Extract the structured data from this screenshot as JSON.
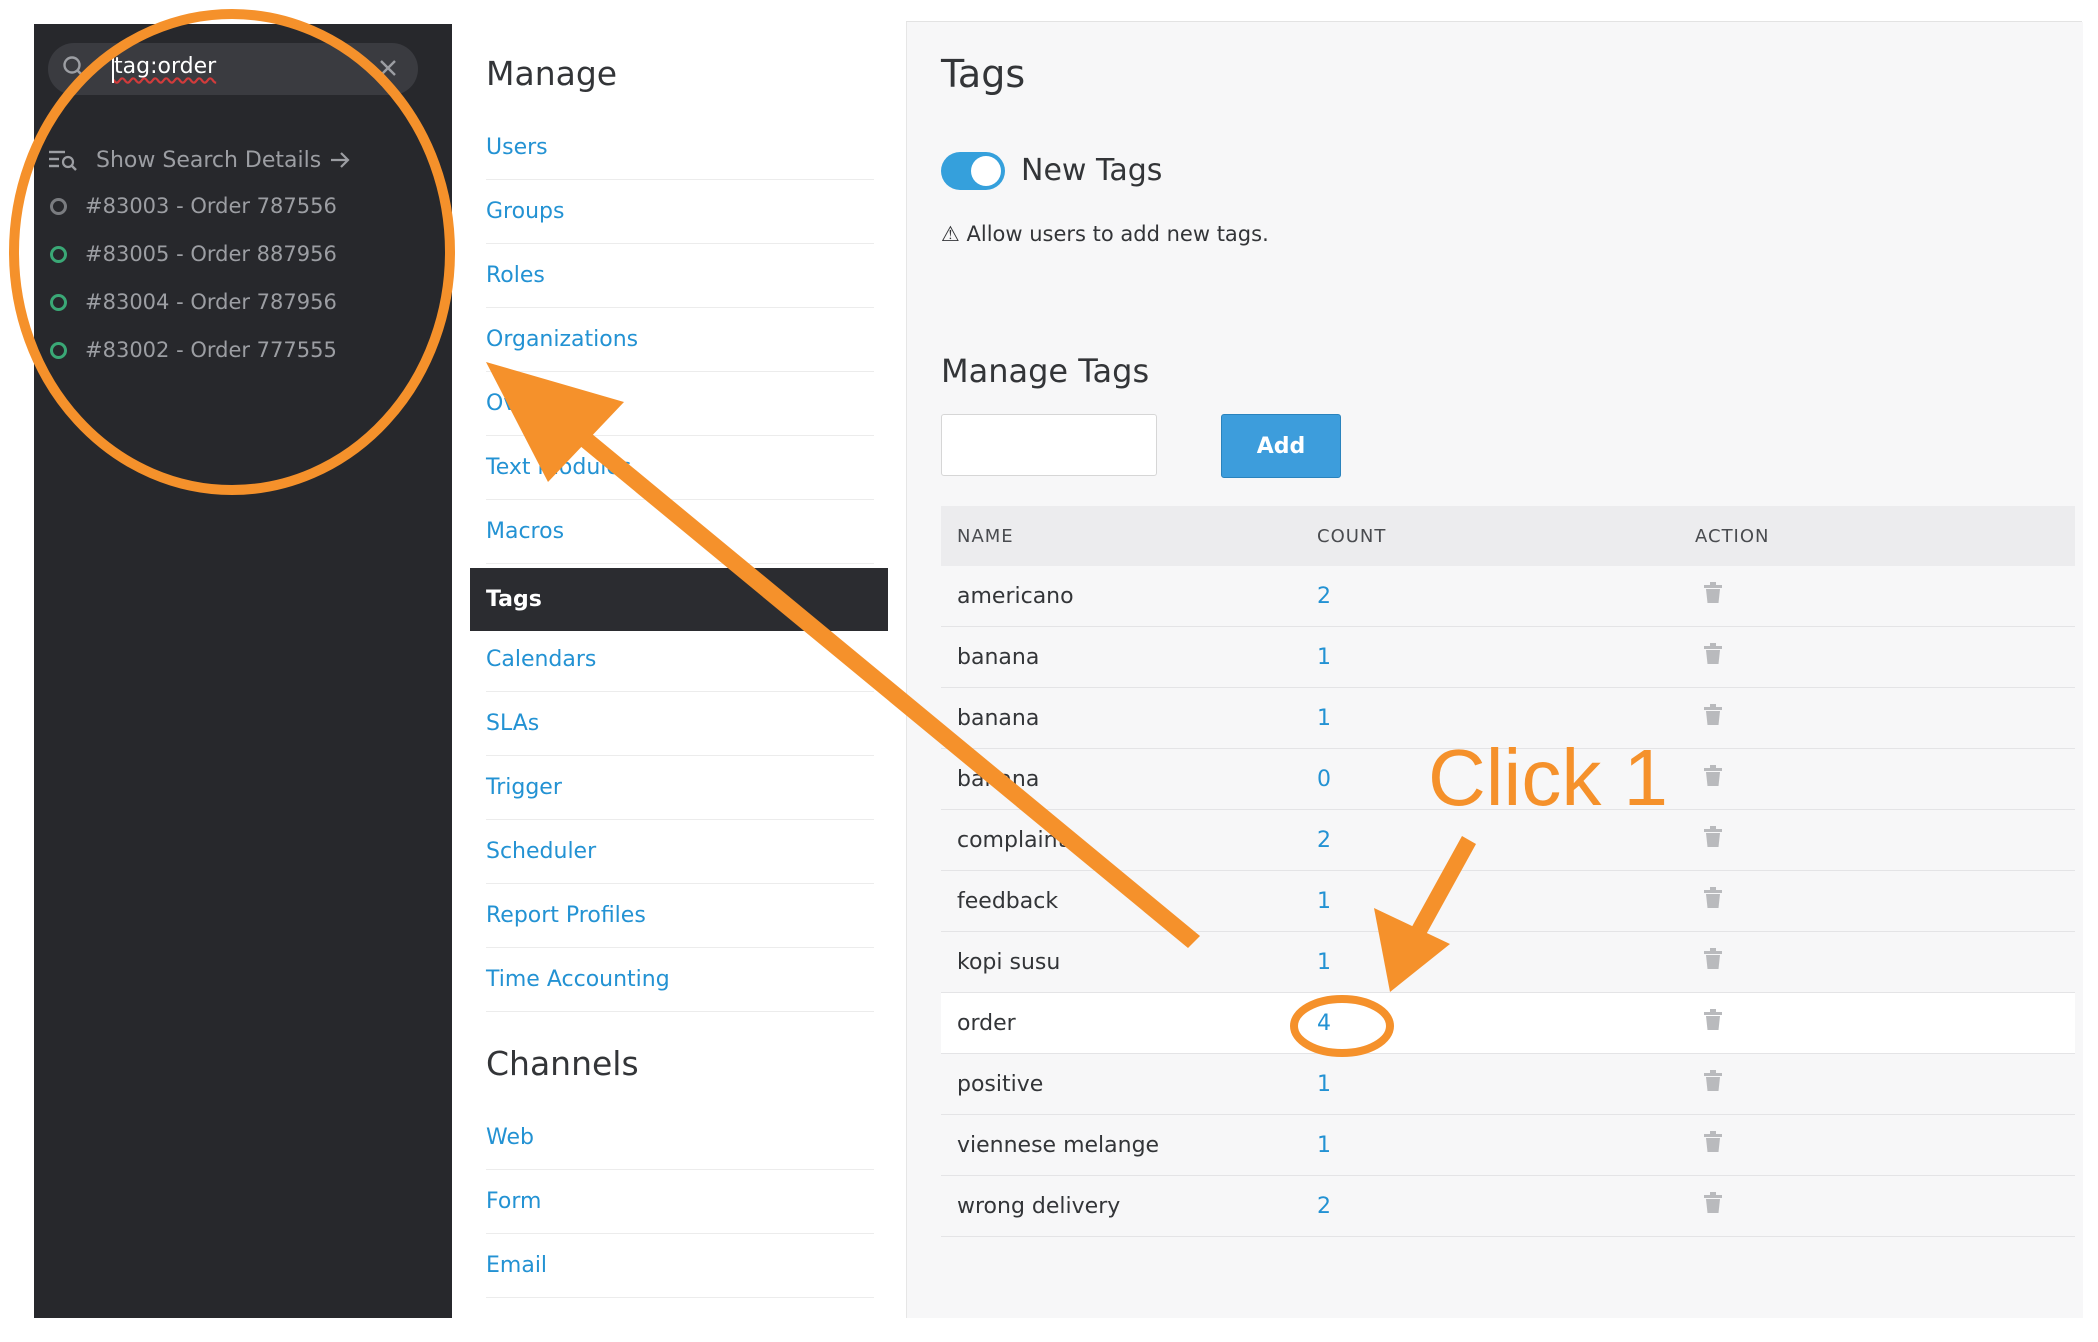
{
  "search": {
    "query": "tag:order",
    "show_details_label": "Show Search Details",
    "results": [
      {
        "label": "#83003 - Order 787556",
        "status": "closed"
      },
      {
        "label": "#83005 - Order 887956",
        "status": "open"
      },
      {
        "label": "#83004 - Order 787956",
        "status": "open"
      },
      {
        "label": "#83002 - Order 777555",
        "status": "open"
      }
    ]
  },
  "menu": {
    "manage_title": "Manage",
    "items": [
      "Users",
      "Groups",
      "Roles",
      "Organizations",
      "Overviews",
      "Text modules",
      "Macros",
      "Tags",
      "Calendars",
      "SLAs",
      "Trigger",
      "Scheduler",
      "Report Profiles",
      "Time Accounting"
    ],
    "active": "Tags",
    "channels_title": "Channels",
    "channels": [
      "Web",
      "Form",
      "Email"
    ]
  },
  "content": {
    "title": "Tags",
    "toggle_label": "New Tags",
    "toggle_on": true,
    "hint": "⚠ Allow users to add new tags.",
    "manage_title": "Manage Tags",
    "add_label": "Add",
    "table": {
      "headers": {
        "name": "NAME",
        "count": "COUNT",
        "action": "ACTION"
      },
      "rows": [
        {
          "name": "americano",
          "count": "2"
        },
        {
          "name": "banana",
          "count": "1"
        },
        {
          "name": "banana",
          "count": "1"
        },
        {
          "name": "banana",
          "count": "0"
        },
        {
          "name": "complaint",
          "count": "2"
        },
        {
          "name": "feedback",
          "count": "1"
        },
        {
          "name": "kopi susu",
          "count": "1"
        },
        {
          "name": "order",
          "count": "4"
        },
        {
          "name": "positive",
          "count": "1"
        },
        {
          "name": "viennese melange",
          "count": "1"
        },
        {
          "name": "wrong delivery",
          "count": "2"
        }
      ]
    }
  },
  "annotation": {
    "callout": "Click 1",
    "color": "#f5912b"
  },
  "colors": {
    "sidebar_bg": "#27282c",
    "link": "#2392d3",
    "accent": "#35a0dc",
    "open_status": "#3aa876"
  }
}
